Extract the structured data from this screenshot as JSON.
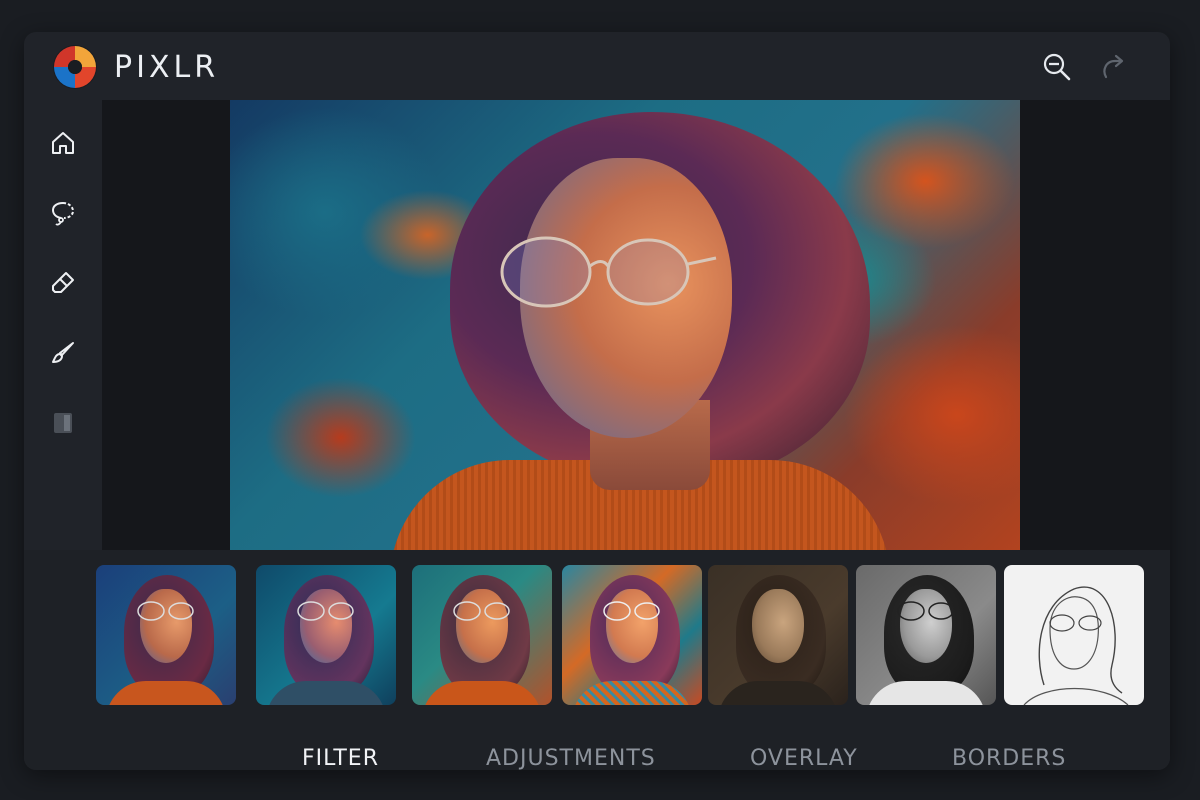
{
  "header": {
    "app_name": "PIXLR",
    "logo_icon": "aperture-logo-icon",
    "actions": [
      {
        "icon": "zoom-out-icon"
      },
      {
        "icon": "redo-icon"
      }
    ]
  },
  "sidebar": {
    "items": [
      {
        "icon": "home-icon"
      },
      {
        "icon": "lasso-icon"
      },
      {
        "icon": "eraser-icon"
      },
      {
        "icon": "brush-icon"
      },
      {
        "icon": "layer-icon"
      }
    ]
  },
  "filters": {
    "thumbnails": [
      {
        "style": "original"
      },
      {
        "style": "cool-blue"
      },
      {
        "style": "teal-orange"
      },
      {
        "style": "vivid-texture"
      },
      {
        "style": "sepia"
      },
      {
        "style": "black-white"
      },
      {
        "style": "pencil-sketch"
      }
    ]
  },
  "tabs": [
    {
      "label": "FILTER",
      "active": true
    },
    {
      "label": "ADJUSTMENTS",
      "active": false
    },
    {
      "label": "OVERLAY",
      "active": false
    },
    {
      "label": "BORDERS",
      "active": false
    }
  ],
  "colors": {
    "background": "#1a1d22",
    "panel": "#202329",
    "canvas": "#15171b",
    "text_active": "#f1f3f6",
    "text_inactive": "#8d939c",
    "logo_red": "#e2452b",
    "logo_orange": "#f2a53a",
    "logo_blue": "#1b73c8"
  }
}
